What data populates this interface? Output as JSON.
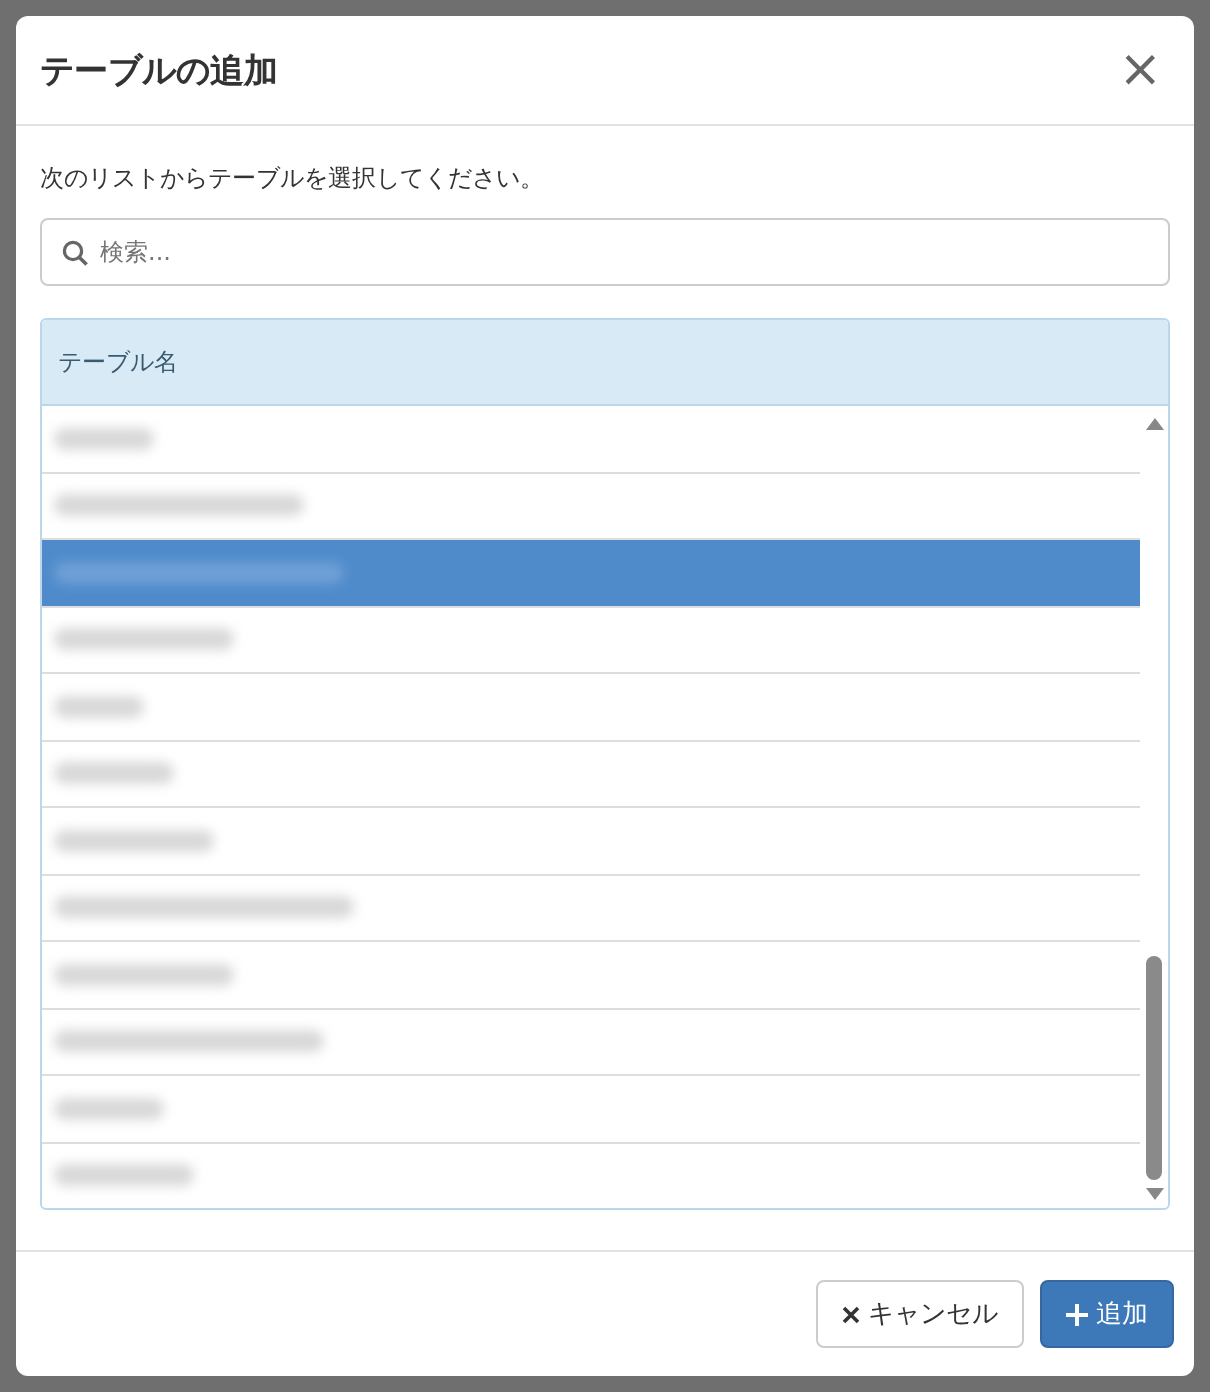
{
  "dialog": {
    "title": "テーブルの追加",
    "close_label": "×",
    "instruction": "次のリストからテーブルを選択してください。"
  },
  "search": {
    "placeholder": "検索..."
  },
  "table": {
    "columns": [
      "テーブル名"
    ],
    "rows": [
      {
        "selected": false
      },
      {
        "selected": false
      },
      {
        "selected": true
      },
      {
        "selected": false
      },
      {
        "selected": false
      },
      {
        "selected": false
      },
      {
        "selected": false
      },
      {
        "selected": false
      },
      {
        "selected": false
      },
      {
        "selected": false
      },
      {
        "selected": false
      },
      {
        "selected": false
      }
    ]
  },
  "buttons": [
    {
      "kind": "cancel",
      "label": "キャンセル"
    },
    {
      "kind": "add",
      "label": "追加"
    }
  ]
}
